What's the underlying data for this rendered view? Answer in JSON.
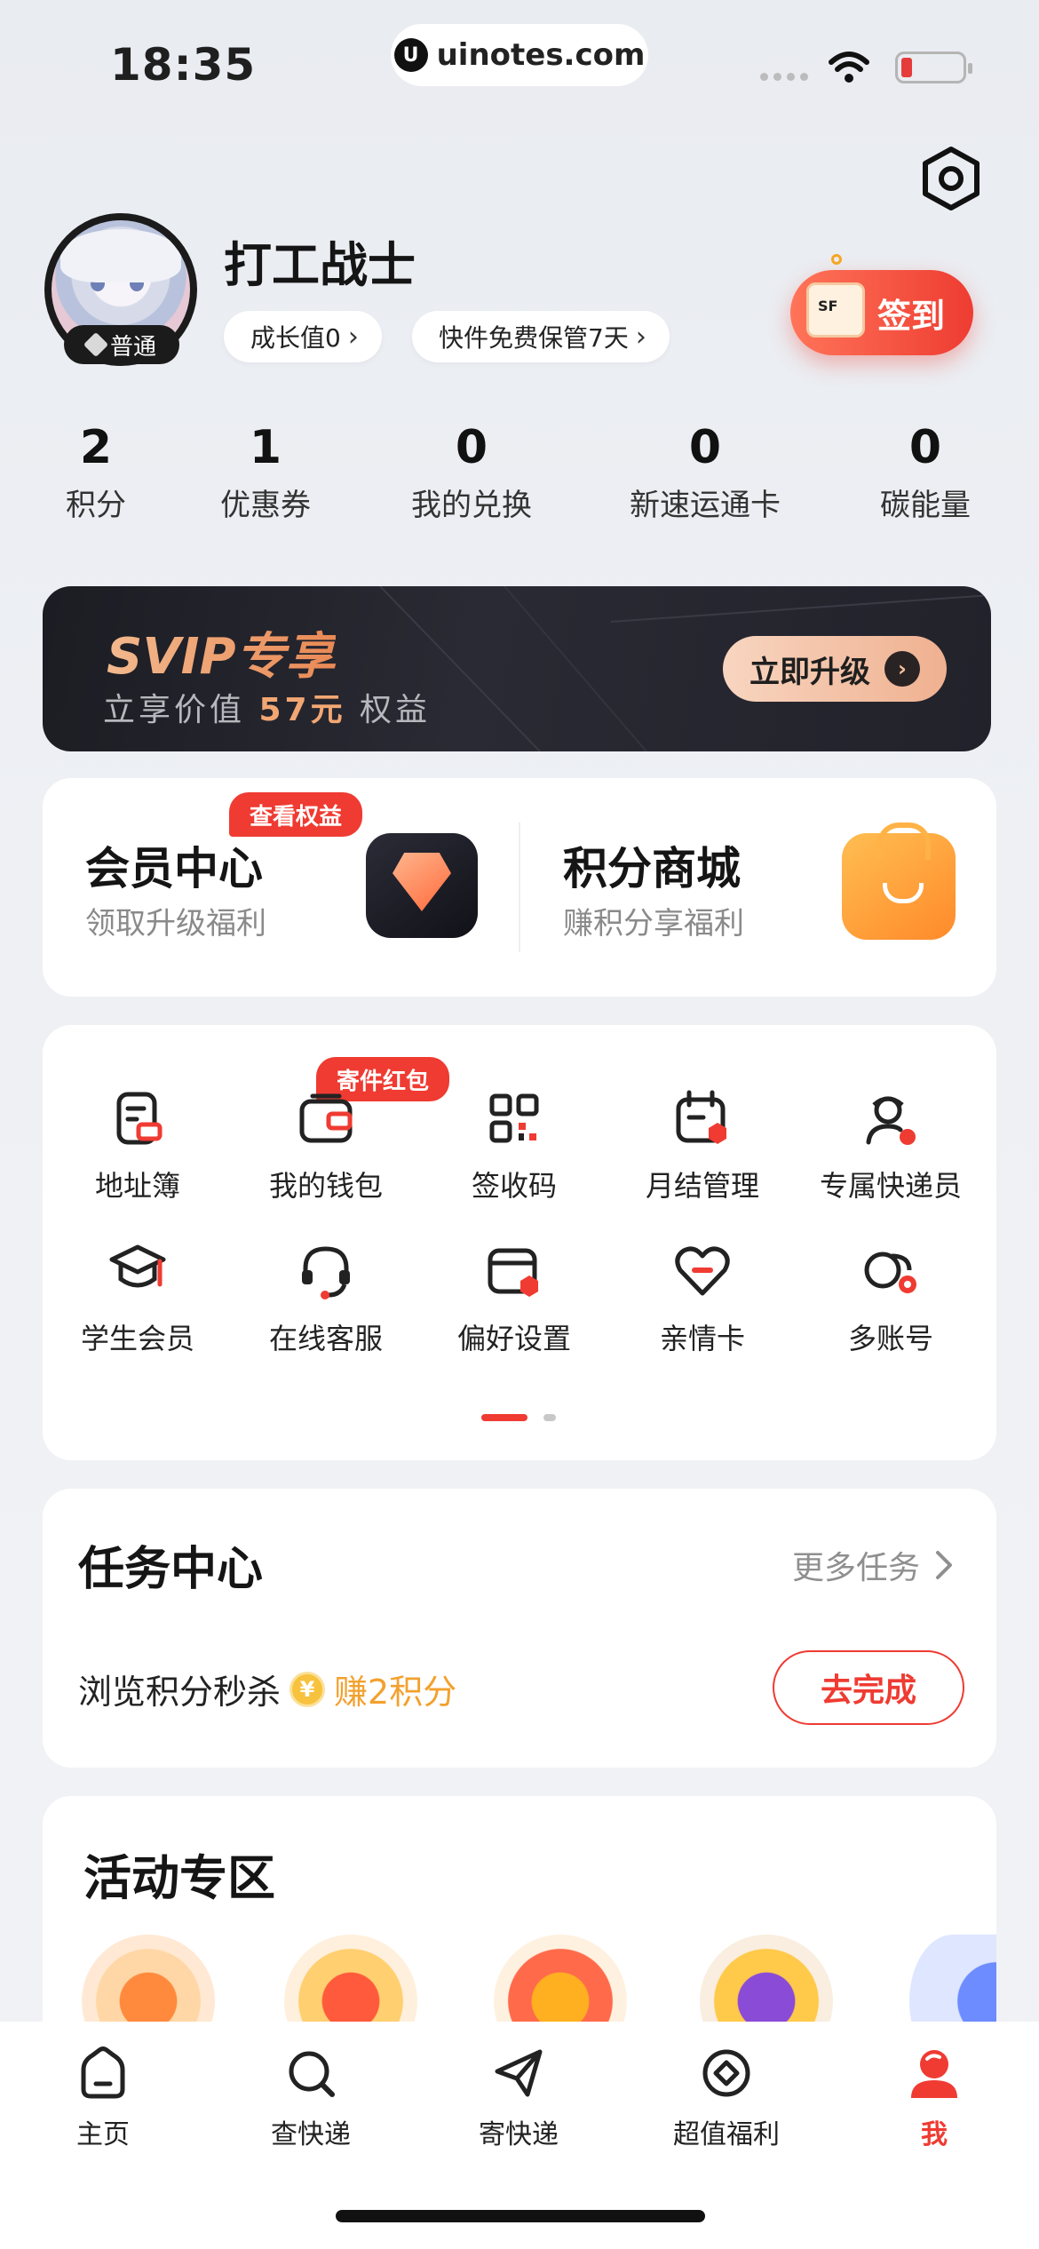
{
  "status_bar": {
    "time": "18:35",
    "url": "uinotes.com",
    "url_logo_letter": "U"
  },
  "profile": {
    "username": "打工战士",
    "level_badge": "普通",
    "growth_chip": "成长值0",
    "keep_chip": "快件免费保管7天",
    "checkin_label": "签到"
  },
  "stats": [
    {
      "value": "2",
      "label": "积分"
    },
    {
      "value": "1",
      "label": "优惠券"
    },
    {
      "value": "0",
      "label": "我的兑换"
    },
    {
      "value": "0",
      "label": "新速运通卡"
    },
    {
      "value": "0",
      "label": "碳能量"
    }
  ],
  "svip": {
    "title": "SVIP专享",
    "sub_prefix": "立享价值",
    "sub_value": "57元",
    "sub_suffix": "权益",
    "button_label": "立即升级",
    "button_arrow": "›"
  },
  "member_cards": [
    {
      "title": "会员中心",
      "subtitle": "领取升级福利",
      "tag": "查看权益"
    },
    {
      "title": "积分商城",
      "subtitle": "赚积分享福利"
    }
  ],
  "services": {
    "tag": "寄件红包",
    "items": [
      {
        "label": "地址簿",
        "icon": "address-book-icon"
      },
      {
        "label": "我的钱包",
        "icon": "wallet-icon"
      },
      {
        "label": "签收码",
        "icon": "qr-code-icon"
      },
      {
        "label": "月结管理",
        "icon": "calendar-icon"
      },
      {
        "label": "专属快递员",
        "icon": "courier-icon"
      },
      {
        "label": "学生会员",
        "icon": "graduation-cap-icon"
      },
      {
        "label": "在线客服",
        "icon": "headset-icon"
      },
      {
        "label": "偏好设置",
        "icon": "preferences-icon"
      },
      {
        "label": "亲情卡",
        "icon": "heart-link-icon"
      },
      {
        "label": "多账号",
        "icon": "multi-account-icon"
      }
    ],
    "page_count": 2,
    "active_page": 1
  },
  "tasks": {
    "title": "任务中心",
    "more_label": "更多任务",
    "item_label": "浏览积分秒杀",
    "coin_symbol": "¥",
    "reward": "赚2积分",
    "button_label": "去完成"
  },
  "activities": {
    "title": "活动专区"
  },
  "tabbar": [
    {
      "label": "主页",
      "icon": "home-icon"
    },
    {
      "label": "查快递",
      "icon": "search-icon"
    },
    {
      "label": "寄快递",
      "icon": "send-icon"
    },
    {
      "label": "超值福利",
      "icon": "benefits-icon"
    },
    {
      "label": "我",
      "icon": "profile-icon",
      "active": true
    }
  ],
  "colors": {
    "accent": "#ef3b32",
    "gold": "#f2a12f",
    "svip_dark": "#1c1c23"
  }
}
